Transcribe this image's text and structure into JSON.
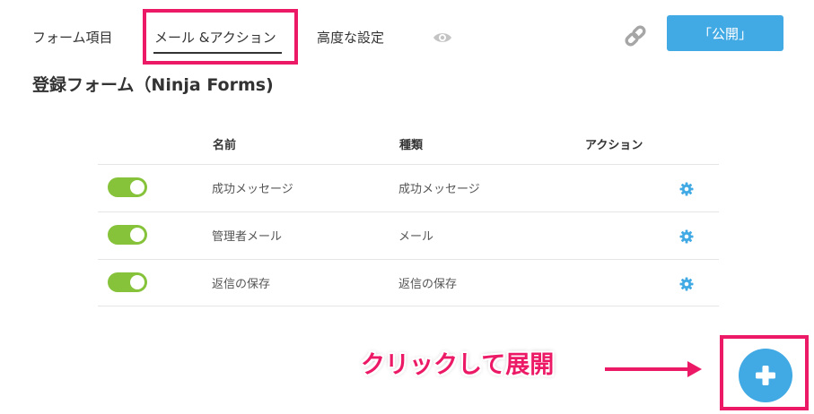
{
  "colors": {
    "accent": "#41a9e4",
    "highlight": "#ec1a66",
    "toggle_on": "#86c33a",
    "text": "#333333"
  },
  "tabs": [
    {
      "label": "フォーム項目",
      "active": false
    },
    {
      "label": "メール &アクション",
      "active": true
    },
    {
      "label": "高度な設定",
      "active": false
    }
  ],
  "toolbar": {
    "preview_icon": "eye-icon",
    "link_icon": "link-icon",
    "publish_label": "「公開」"
  },
  "form_title": "登録フォーム（Ninja Forms)",
  "table": {
    "headers": {
      "name": "名前",
      "type": "種類",
      "action": "アクション"
    },
    "rows": [
      {
        "enabled": true,
        "name": "成功メッセージ",
        "type": "成功メッセージ",
        "settings_icon": "gear-icon"
      },
      {
        "enabled": true,
        "name": "管理者メール",
        "type": "メール",
        "settings_icon": "gear-icon"
      },
      {
        "enabled": true,
        "name": "返信の保存",
        "type": "返信の保存",
        "settings_icon": "gear-icon"
      }
    ]
  },
  "annotation": {
    "text": "クリックして展開",
    "arrow_icon": "arrow-right-icon"
  },
  "add_button": {
    "icon": "plus-icon"
  }
}
